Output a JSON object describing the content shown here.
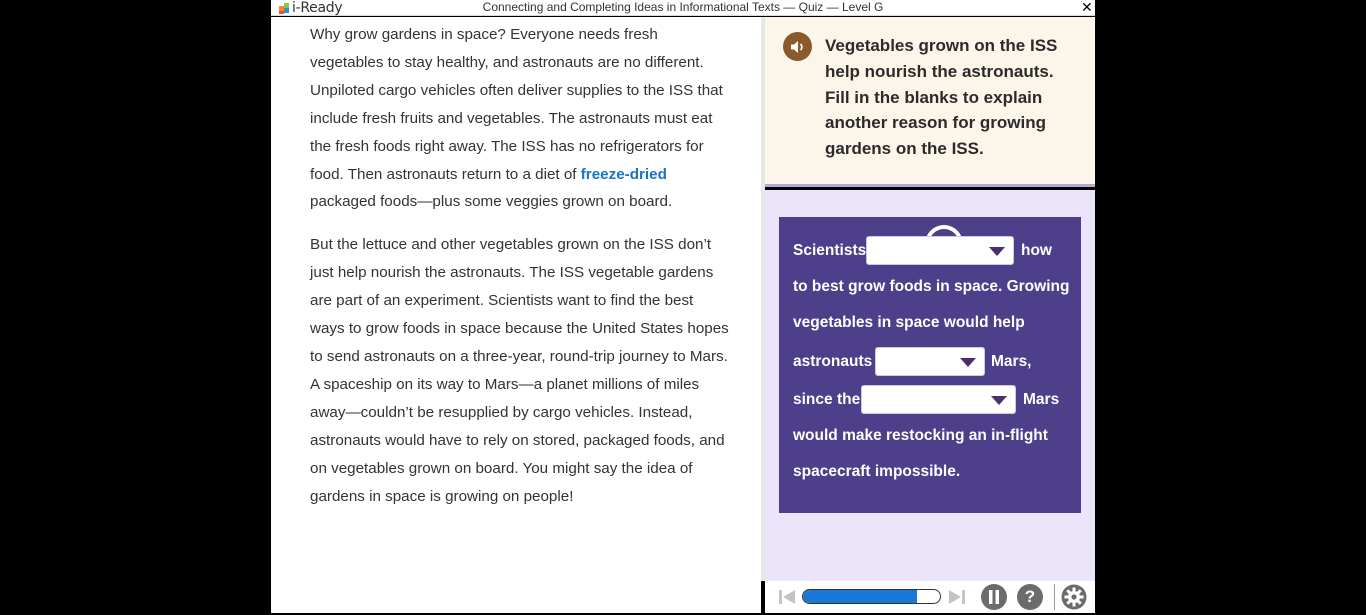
{
  "app": {
    "logo_text": "i-Ready",
    "window_title": "Connecting and Completing Ideas in Informational Texts — Quiz — Level G",
    "close_glyph": "✕"
  },
  "passage": {
    "p1_before": "Why grow gardens in space? Everyone needs fresh vegetables to stay healthy, and astronauts are no different. Unpiloted cargo vehicles often deliver supplies to the ISS that include fresh fruits and vegetables. The astronauts must eat the fresh foods right away. The ISS has no refrigerators for food. Then astronauts return to a diet of ",
    "p1_glossary": "freeze-dried",
    "p1_after": " packaged foods—plus some veggies grown on board.",
    "p2": "But the lettuce and other vegetables grown on the ISS don’t just help nourish the astronauts. The ISS vegetable gardens are part of an experiment. Scientists want to find the best ways to grow foods in space because the United States hopes to send astronauts on a three-year, round-trip journey to Mars. A spaceship on its way to Mars—a planet millions of miles away—couldn’t be resupplied by cargo vehicles. Instead, astronauts would have to rely on stored, packaged foods, and on vegetables grown on board. You might say the idea of gardens in space is growing on people!"
  },
  "question": {
    "prompt": "Vegetables grown on the ISS help nourish the astronauts. Fill in the blanks to explain another reason for growing gardens on the ISS.",
    "prompt_audio_icon": "speaker-icon",
    "card_audio_icon": "speaker-icon",
    "sentence": {
      "s1": "Scientists",
      "s2": "how",
      "s3": "to best grow foods in space. Growing",
      "s4": "vegetables in space would help",
      "s5": "astronauts",
      "s6": "Mars,",
      "s7": "since the",
      "s8": "Mars",
      "s9": "would make restocking an in-flight",
      "s10": "spacecraft impossible."
    },
    "dropdowns": [
      {
        "selected": ""
      },
      {
        "selected": ""
      },
      {
        "selected": ""
      }
    ]
  },
  "toolbar": {
    "progress_fraction": 0.83,
    "help_label": "?",
    "icons": [
      "skip-back-icon",
      "skip-forward-icon",
      "pause-icon",
      "help-icon",
      "settings-icon"
    ]
  },
  "colors": {
    "accent_purple": "#4d3f8a",
    "glossary_blue": "#1a73c8",
    "progress_blue": "#1778d6",
    "prompt_bg": "#fcf6ea"
  }
}
